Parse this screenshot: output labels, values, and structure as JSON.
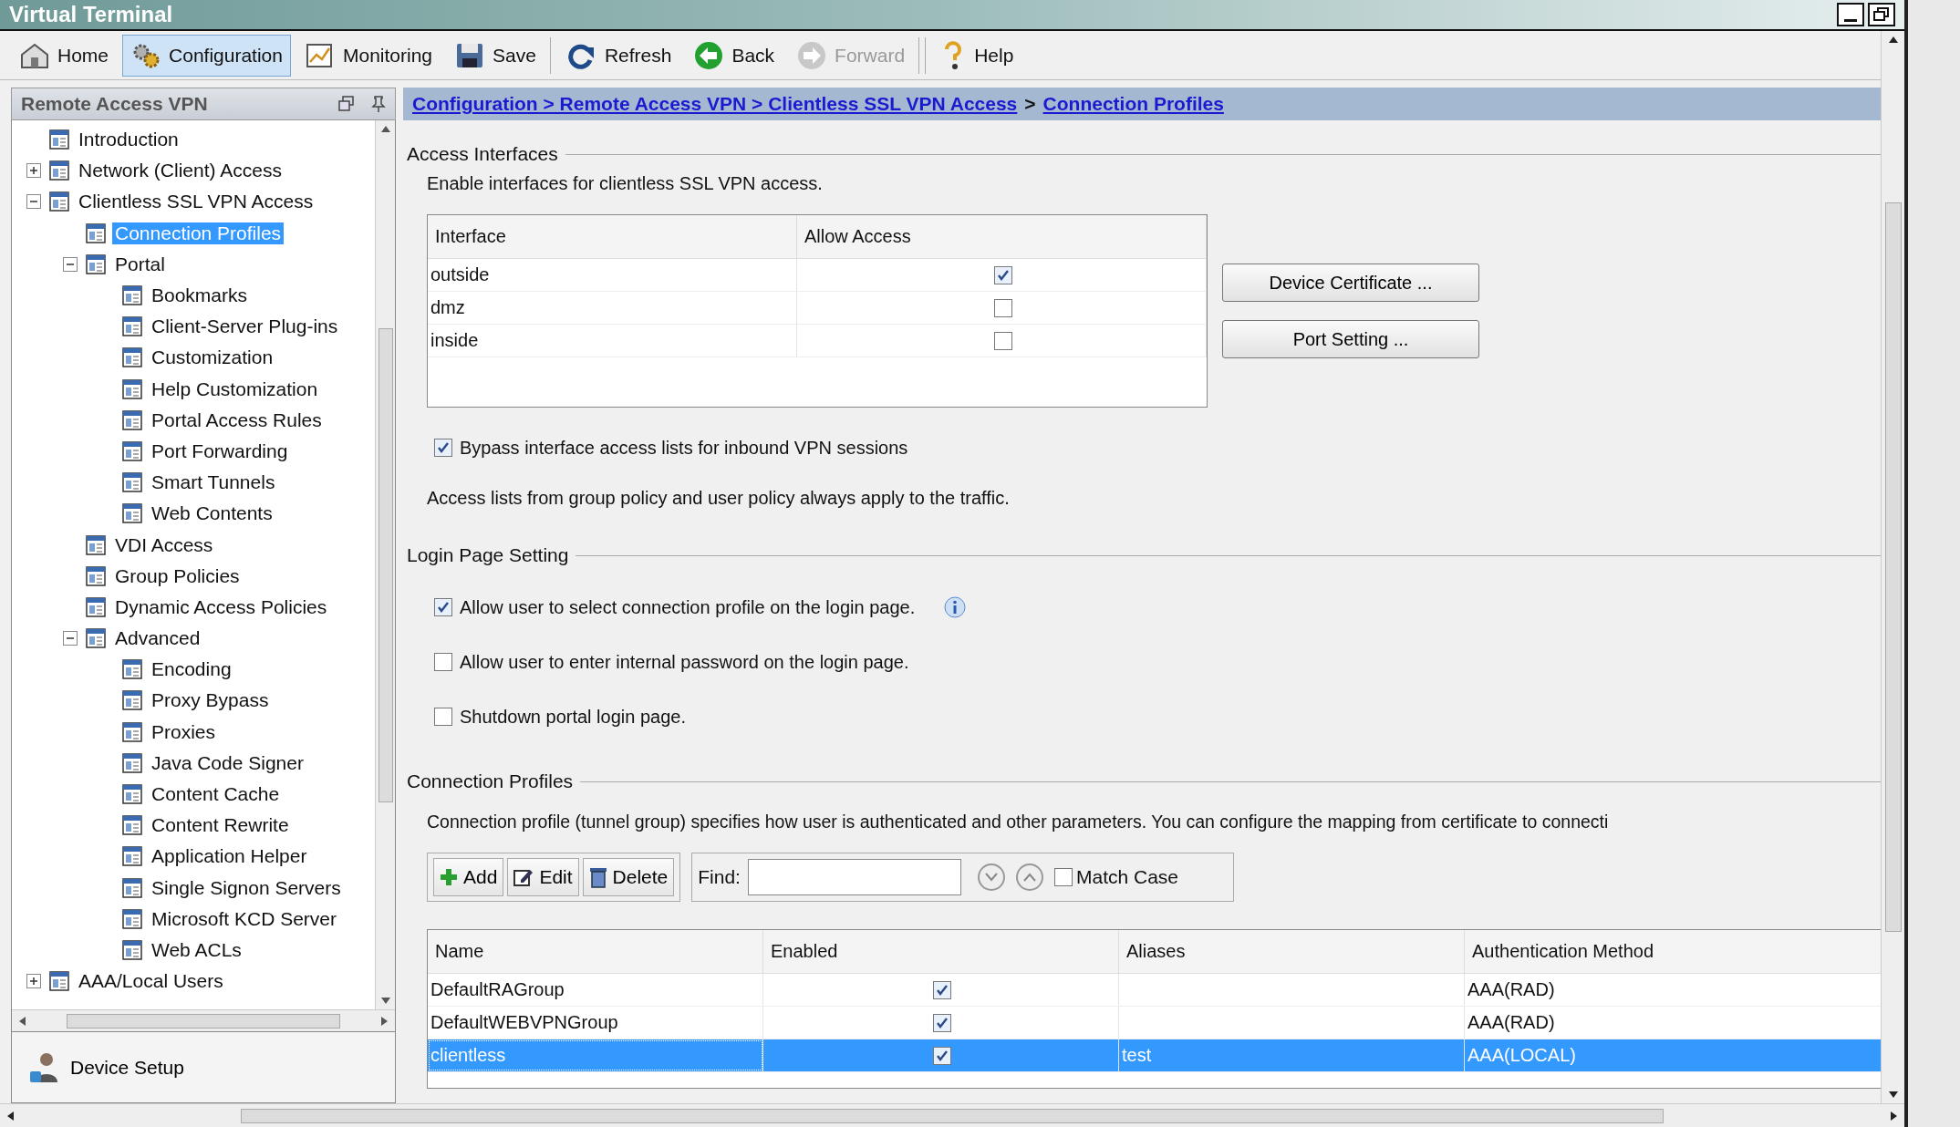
{
  "window": {
    "title": "Virtual Terminal"
  },
  "toolbar": [
    {
      "kind": "home",
      "label": "Home",
      "selected": false,
      "disabled": false
    },
    {
      "kind": "configuration",
      "label": "Configuration",
      "selected": true,
      "disabled": false
    },
    {
      "kind": "monitoring",
      "label": "Monitoring",
      "selected": false,
      "disabled": false
    },
    {
      "kind": "save",
      "label": "Save",
      "selected": false,
      "disabled": false
    },
    {
      "kind": "refresh",
      "label": "Refresh",
      "selected": false,
      "disabled": false
    },
    {
      "kind": "back",
      "label": "Back",
      "selected": false,
      "disabled": false
    },
    {
      "kind": "forward",
      "label": "Forward",
      "selected": false,
      "disabled": true
    },
    {
      "kind": "help",
      "label": "Help",
      "selected": false,
      "disabled": false
    }
  ],
  "nav_panel": {
    "title": "Remote Access VPN",
    "tree": [
      {
        "label": "Introduction",
        "selected": false
      },
      {
        "label": "Network (Client) Access",
        "selected": false,
        "expanded": false
      },
      {
        "label": "Clientless SSL VPN Access",
        "selected": false,
        "expanded": true,
        "children": [
          {
            "label": "Connection Profiles",
            "selected": true
          },
          {
            "label": "Portal",
            "selected": false,
            "expanded": true,
            "children": [
              {
                "label": "Bookmarks",
                "selected": false
              },
              {
                "label": "Client-Server Plug-ins",
                "selected": false
              },
              {
                "label": "Customization",
                "selected": false
              },
              {
                "label": "Help Customization",
                "selected": false
              },
              {
                "label": "Portal Access Rules",
                "selected": false
              },
              {
                "label": "Port Forwarding",
                "selected": false
              },
              {
                "label": "Smart Tunnels",
                "selected": false
              },
              {
                "label": "Web Contents",
                "selected": false
              }
            ]
          },
          {
            "label": "VDI Access",
            "selected": false
          },
          {
            "label": "Group Policies",
            "selected": false
          },
          {
            "label": "Dynamic Access Policies",
            "selected": false
          },
          {
            "label": "Advanced",
            "selected": false,
            "expanded": true,
            "children": [
              {
                "label": "Encoding",
                "selected": false
              },
              {
                "label": "Proxy Bypass",
                "selected": false
              },
              {
                "label": "Proxies",
                "selected": false
              },
              {
                "label": "Java Code Signer",
                "selected": false
              },
              {
                "label": "Content Cache",
                "selected": false
              },
              {
                "label": "Content Rewrite",
                "selected": false
              },
              {
                "label": "Application Helper",
                "selected": false
              },
              {
                "label": "Single Signon Servers",
                "selected": false
              },
              {
                "label": "Microsoft KCD Server",
                "selected": false
              },
              {
                "label": "Web ACLs",
                "selected": false
              }
            ]
          }
        ]
      },
      {
        "label": "AAA/Local Users",
        "selected": false,
        "expanded": false
      }
    ],
    "footer_button": "Device Setup"
  },
  "breadcrumb": {
    "path": "Configuration > Remote Access VPN > Clientless SSL VPN Access",
    "separator": ">",
    "current": "Connection Profiles"
  },
  "access_interfaces": {
    "legend": "Access Interfaces",
    "description": "Enable interfaces for clientless SSL VPN access.",
    "columns": [
      "Interface",
      "Allow Access"
    ],
    "rows": [
      {
        "interface": "outside",
        "allow_access": true
      },
      {
        "interface": "dmz",
        "allow_access": false
      },
      {
        "interface": "inside",
        "allow_access": false
      }
    ],
    "buttons": [
      "Device Certificate ...",
      "Port Setting ..."
    ],
    "bypass": {
      "label": "Bypass interface access lists for inbound VPN sessions",
      "checked": true
    },
    "note": "Access lists from group policy and user policy always apply to the traffic."
  },
  "login_page_setting": {
    "legend": "Login Page Setting",
    "options": [
      {
        "label": "Allow user to select connection profile on the login page.",
        "checked": true,
        "info": true
      },
      {
        "label": "Allow user to enter internal password on the login page.",
        "checked": false,
        "info": false
      },
      {
        "label": "Shutdown portal login page.",
        "checked": false,
        "info": false
      }
    ]
  },
  "connection_profiles": {
    "legend": "Connection Profiles",
    "description": "Connection profile (tunnel group) specifies how user is authenticated and other parameters. You can configure the mapping from certificate to connecti",
    "actions": [
      {
        "kind": "add",
        "label": "Add"
      },
      {
        "kind": "edit",
        "label": "Edit"
      },
      {
        "kind": "delete",
        "label": "Delete"
      }
    ],
    "find_label": "Find:",
    "match_case": {
      "label": "Match Case",
      "checked": false
    },
    "columns": [
      "Name",
      "Enabled",
      "Aliases",
      "Authentication Method"
    ],
    "rows": [
      {
        "name": "DefaultRAGroup",
        "enabled": true,
        "auth": "AAA(RAD)",
        "selected": false
      },
      {
        "name": "DefaultWEBVPNGroup",
        "enabled": true,
        "auth": "AAA(RAD)",
        "selected": false
      },
      {
        "name": "clientless",
        "enabled": true,
        "aliases": "test",
        "auth": "AAA(LOCAL)",
        "selected": true
      }
    ]
  }
}
